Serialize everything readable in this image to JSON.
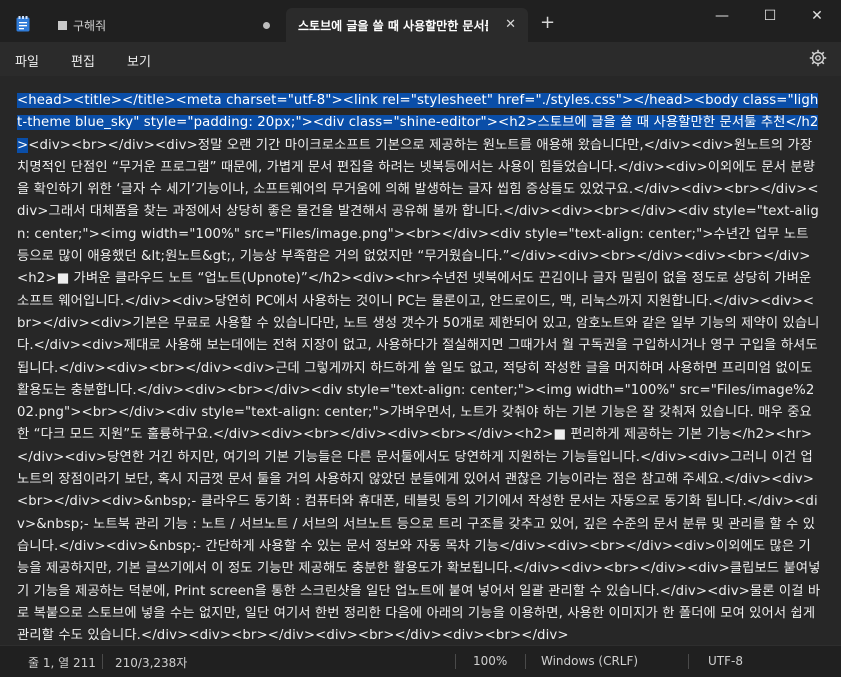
{
  "tabs": {
    "inactive_label": "구해줘",
    "active_label": "스토브에 글을 쓸 때 사용할만한 문서툴",
    "close_glyph": "✕",
    "new_tab_glyph": "+"
  },
  "window_controls": {
    "minimize": "—",
    "maximize": "☐",
    "close": "✕"
  },
  "menu": {
    "file": "파일",
    "edit": "편집",
    "view": "보기"
  },
  "editor": {
    "selected_text": "<head><title></title><meta charset=\"utf-8\"><link rel=\"stylesheet\" href=\"./styles.css\"></head><body class=\"light-theme blue_sky\" style=\"padding: 20px;\"><div class=\"shine-editor\"><h2>스토브에 글을 쓸 때 사용할만한 문서툴 추천</h2>",
    "rest_text": "<div><br></div><div>정말 오랜 기간 마이크로소프트 기본으로 제공하는 원노트를 애용해 왔습니다만,</div><div>원노트의 가장 치명적인 단점인 “무거운 프로그램” 때문에, 가볍게 문서 편집을 하려는 넷북등에서는 사용이 힘들었습니다.</div><div>이외에도 문서 분량을 확인하기 위한 ‘글자 수 세기’기능이나, 소프트웨어의 무거움에 의해 발생하는 글자 씹힘 증상들도 있었구요.</div><div><br></div><div>그래서 대체품을 찾는 과정에서 상당히 좋은 물건을 발견해서 공유해 볼까 합니다.</div><div><br></div><div style=\"text-align: center;\"><img width=\"100%\" src=\"Files/image.png\"><br></div><div style=\"text-align: center;\">수년간 업무 노트 등으로 많이 애용했던 &lt;원노트&gt;, 기능상 부족함은 거의 없었지만 “무거웠습니다.”</div><div><br></div><div><br></div><h2>■ 가벼운 클라우드 노트 “업노트(Upnote)”</h2><div><hr>수년전 넷북에서도 끈김이나 글자 밀림이 없을 정도로 상당히 가벼운 소프트 웨어입니다.</div><div>당연히 PC에서 사용하는 것이니 PC는 물론이고, 안드로이드, 맥, 리눅스까지 지원합니다.</div><div><br></div><div>기본은 무료로 사용할 수 있습니다만, 노트 생성 갯수가 50개로 제한되어 있고, 암호노트와 같은 일부 기능의 제약이 있습니다.</div><div>제대로 사용해 보는데에는 전혀 지장이 없고, 사용하다가 절실해지면 그때가서 월 구독권을 구입하시거나 영구 구입을 하셔도 됩니다.</div><div><br></div><div>근데 그렇게까지 하드하게 쓸 일도 없고, 적당히 작성한 글을 머지하며 사용하면 프리미엄 없이도 활용도는 충분합니다.</div><div><br></div><div style=\"text-align: center;\"><img width=\"100%\" src=\"Files/image%202.png\"><br></div><div style=\"text-align: center;\">가벼우면서, 노트가 갖춰야 하는 기본 기능은 잘 갖춰져 있습니다. 매우 중요한 “다크 모드 지원”도 훌륭하구요.</div><div><br></div><div><br></div><h2>■ 편리하게 제공하는 기본 기능</h2><hr></div><div>당연한 거긴 하지만, 여기의 기본 기능들은 다른 문서툴에서도 당연하게 지원하는 기능들입니다.</div><div>그러니 이건 업노트의 장점이라기 보단, 혹시 지금껏 문서 툴을 거의 사용하지 않았던 분들에게 있어서 괜찮은 기능이라는 점은 참고해 주세요.</div><div><br></div><div>&nbsp;- 클라우드 동기화 : 컴퓨터와 휴대폰, 테블릿 등의 기기에서 작성한 문서는 자동으로 동기화 됩니다.</div><div>&nbsp;- 노트북 관리 기능 : 노트 / 서브노트 / 서브의 서브노트 등으로 트리 구조를 갖추고 있어, 깊은 수준의 문서 분류 및 관리를 할 수 있습니다.</div><div>&nbsp;- 간단하게 사용할 수 있는 문서 정보와 자동 목차 기능</div><div><br></div><div>이외에도 많은 기능을 제공하지만, 기본 글쓰기에서 이 정도 기능만 제공해도 충분한 활용도가 확보됩니다.</div><div><br></div><div>클립보드 붙여넣기 기능을 제공하는 덕분에, Print screen을 통한 스크린샷을 일단 업노트에 붙여 넣어서 일괄 관리할 수 있습니다.</div><div>물론 이걸 바로 복붙으로 스토브에 넣을 수는 없지만, 일단 여기서 한번 정리한 다음에 아래의 기능을 이용하면, 사용한 이미지가 한 폴더에 모여 있어서 쉽게 관리할 수도 있습니다.</div><div><br></div><div><br></div><div><br></div>"
  },
  "status": {
    "position": "줄 1, 열 211",
    "count": "210/3,238자",
    "zoom": "100%",
    "line_ending": "Windows (CRLF)",
    "encoding": "UTF-8"
  }
}
